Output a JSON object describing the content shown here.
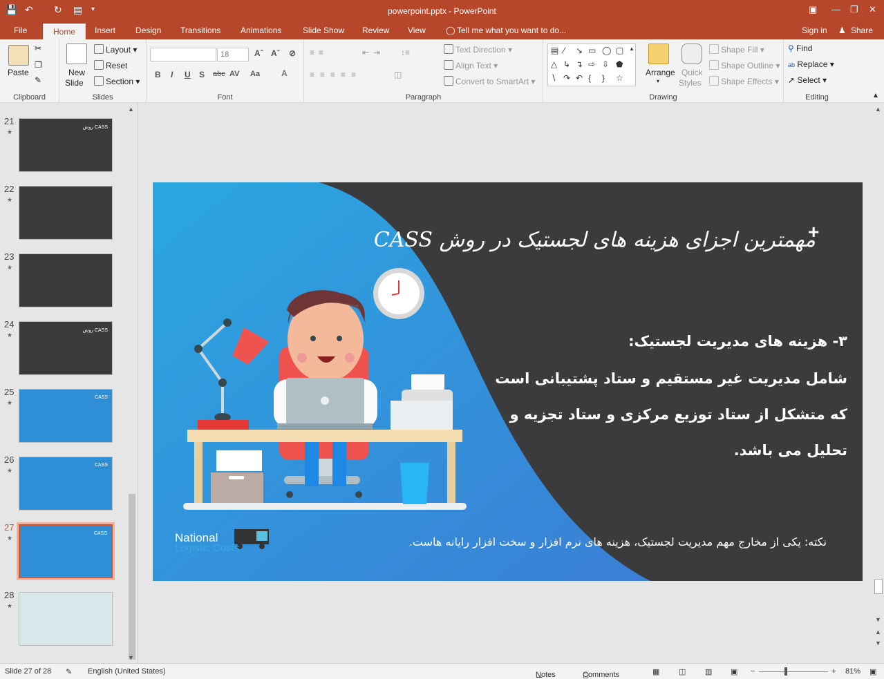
{
  "window": {
    "title": "powerpoint.pptx - PowerPoint"
  },
  "tabs": [
    "File",
    "Home",
    "Insert",
    "Design",
    "Transitions",
    "Animations",
    "Slide Show",
    "Review",
    "View"
  ],
  "tell_me": "Tell me what you want to do...",
  "account": {
    "sign_in": "Sign in",
    "share": "Share"
  },
  "ribbon": {
    "clipboard": {
      "paste": "Paste",
      "label": "Clipboard"
    },
    "slides": {
      "new_slide_1": "New",
      "new_slide_2": "Slide",
      "layout": "Layout",
      "reset": "Reset",
      "section": "Section",
      "label": "Slides"
    },
    "font": {
      "name": "",
      "size": "18",
      "label": "Font"
    },
    "paragraph": {
      "text_direction": "Text Direction",
      "align_text": "Align Text",
      "convert_smartart": "Convert to SmartArt",
      "label": "Paragraph"
    },
    "drawing": {
      "arrange": "Arrange",
      "quick_styles_1": "Quick",
      "quick_styles_2": "Styles",
      "shape_fill": "Shape Fill",
      "shape_outline": "Shape Outline",
      "shape_effects": "Shape Effects",
      "label": "Drawing"
    },
    "editing": {
      "find": "Find",
      "replace": "Replace",
      "select": "Select",
      "label": "Editing"
    }
  },
  "thumbnails": [
    {
      "num": "21",
      "title": "روش CASS",
      "bg": "#3b3b3d"
    },
    {
      "num": "22",
      "title": "",
      "bg": "#3b3b3d"
    },
    {
      "num": "23",
      "title": "",
      "bg": "#3b3b3d"
    },
    {
      "num": "24",
      "title": "روش CASS",
      "bg": "#3b3b3d"
    },
    {
      "num": "25",
      "title": "CASS",
      "bg": "#2f8fd6"
    },
    {
      "num": "26",
      "title": "CASS",
      "bg": "#2f8fd6"
    },
    {
      "num": "27",
      "title": "CASS",
      "bg": "#2f8fd6",
      "selected": true
    },
    {
      "num": "28",
      "title": "",
      "bg": "#d9e8ea"
    }
  ],
  "slide": {
    "title": "مهمترین اجزای هزینه های لجستیک در روش CASS",
    "heading": "۳- هزینه های مدیریت لجستیک:",
    "lines": [
      "شامل مدیریت غیر مستقیم و ستاد پشتیبانی است",
      "که متشکل از ستاد توزیع مرکزی و ستاد تجزیه و",
      "تحلیل می باشد."
    ],
    "note": "نکته: یکی از مخارج مهم مدیریت لجستیک، هزینه های نرم افزار و سخت افزار رایانه هاست.",
    "logo_line1": "National",
    "logo_line2": "Logistic Costs",
    "colors": {
      "dark": "#3b3b3d",
      "blue_start": "#2aa7e0",
      "blue_end": "#3b7fd6"
    }
  },
  "status": {
    "slide": "Slide 27 of 28",
    "language": "English (United States)",
    "notes": "Notes",
    "comments": "Comments",
    "zoom": "81%"
  }
}
